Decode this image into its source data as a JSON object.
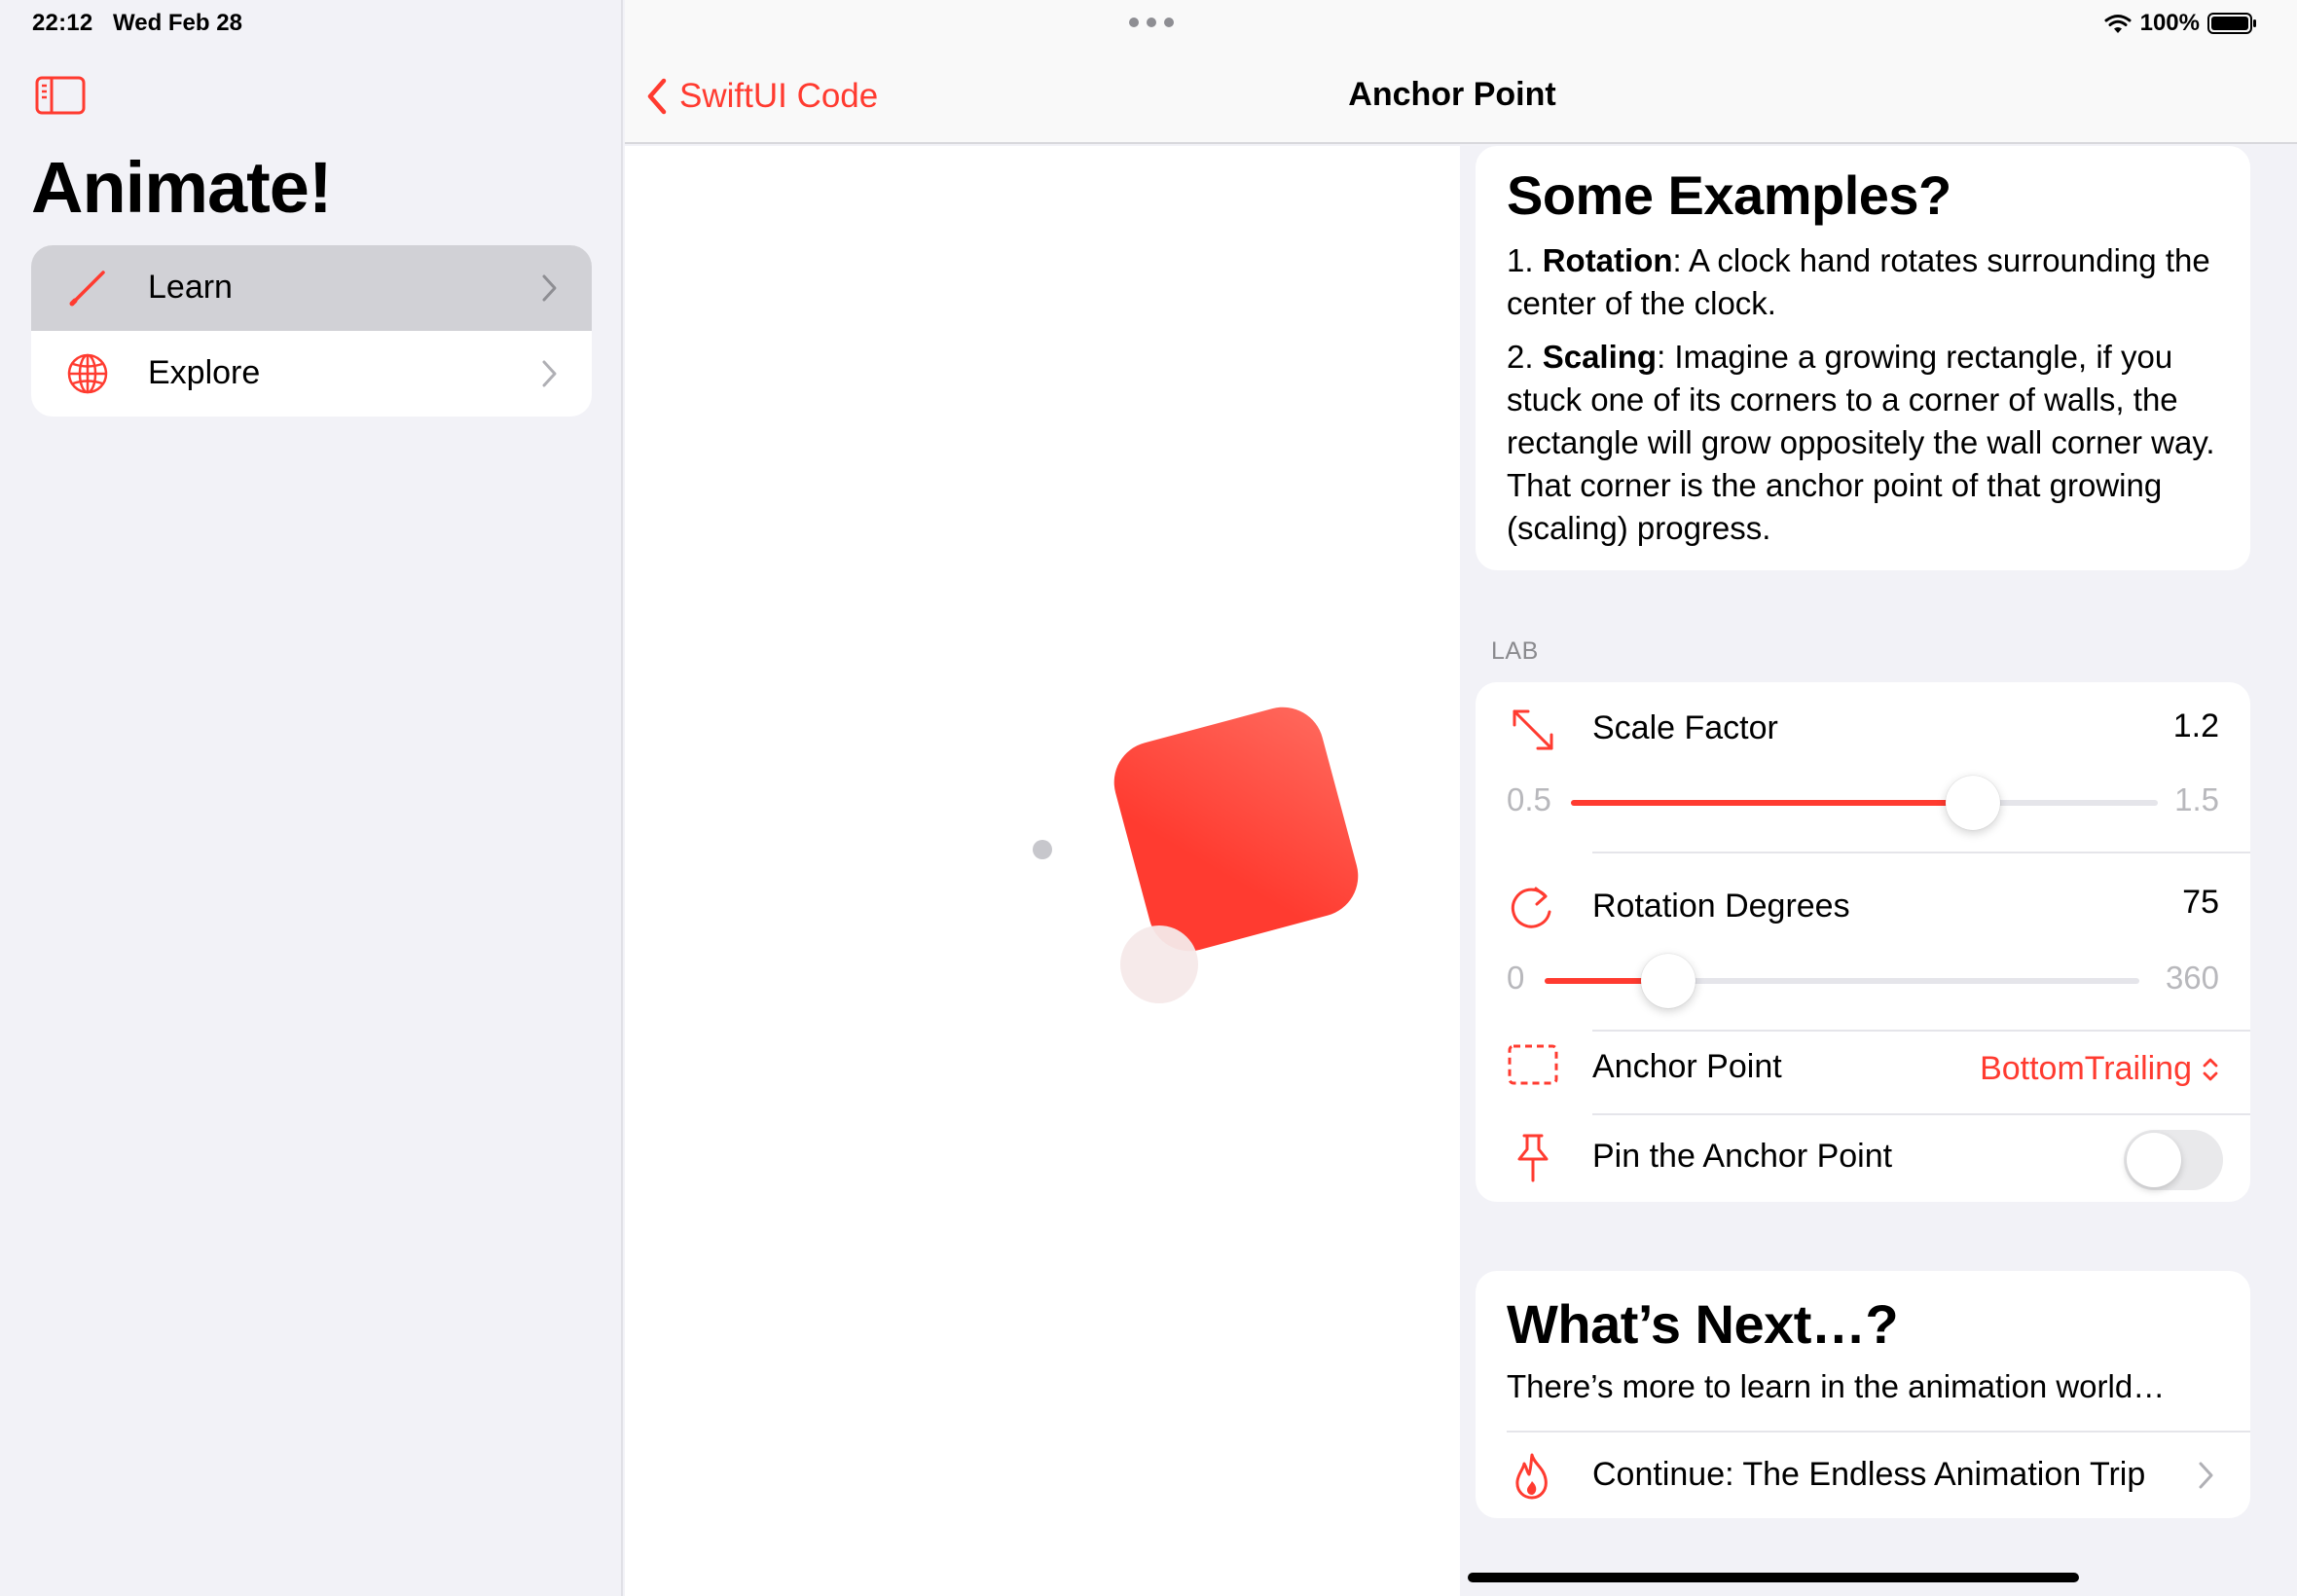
{
  "status_bar": {
    "time": "22:12",
    "date": "Wed Feb 28",
    "battery": "100%"
  },
  "sidebar": {
    "title": "Animate!",
    "items": [
      {
        "label": "Learn",
        "icon": "pencil-icon",
        "selected": true
      },
      {
        "label": "Explore",
        "icon": "globe-icon",
        "selected": false
      }
    ]
  },
  "nav": {
    "back_label": "SwiftUI Code",
    "title": "Anchor Point"
  },
  "examples": {
    "title": "Some Examples?",
    "items": [
      {
        "num": "1. ",
        "bold": "Rotation",
        "text": ": A clock hand rotates surrounding the center of the clock."
      },
      {
        "num": "2. ",
        "bold": "Scaling",
        "text": ": Imagine a growing rectangle, if you stuck one of its corners to a corner of walls, the rectangle will grow oppositely the wall corner way. That corner is the anchor point of that growing (scaling) progress."
      }
    ]
  },
  "lab": {
    "header": "LAB",
    "scale": {
      "label": "Scale Factor",
      "value": "1.2",
      "min": "0.5",
      "max": "1.5",
      "fraction": 0.685,
      "icon": "resize-arrows-icon"
    },
    "rotation": {
      "label": "Rotation Degrees",
      "value": "75",
      "min": "0",
      "max": "360",
      "fraction": 0.2083,
      "icon": "rotate-icon"
    },
    "anchor": {
      "label": "Anchor Point",
      "value": "BottomTrailing",
      "icon": "dashed-rect-icon"
    },
    "pin": {
      "label": "Pin the Anchor Point",
      "on": false,
      "icon": "pin-icon"
    }
  },
  "next": {
    "title": "What’s Next…?",
    "subtitle": "There’s more to learn in the animation world…",
    "link": "Continue: The Endless Animation Trip",
    "icon": "flame-icon"
  },
  "colors": {
    "accent": "#ff3b30",
    "shape_start": "#ff3b30",
    "shape_end": "#ff6a5e"
  }
}
